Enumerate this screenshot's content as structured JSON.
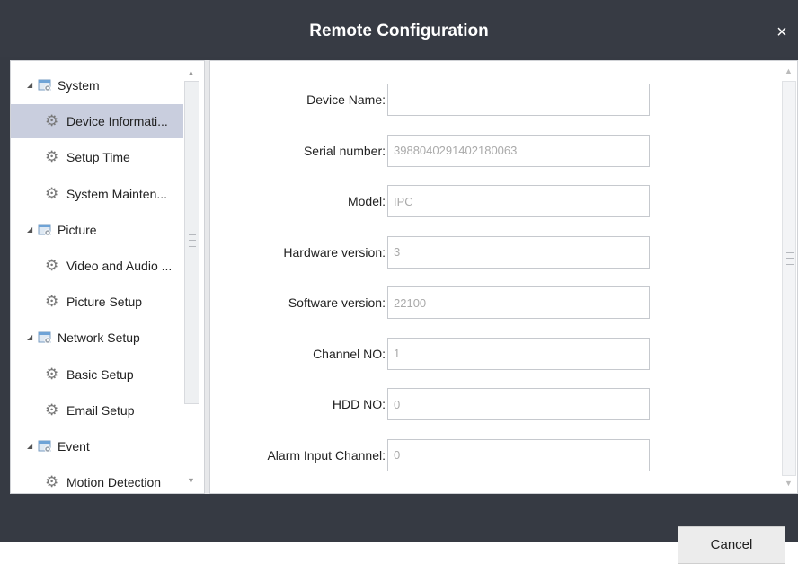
{
  "window": {
    "title": "Remote Configuration",
    "close_glyph": "×"
  },
  "tree": [
    {
      "label": "System",
      "type": "parent",
      "icon": "folder-gear-icon"
    },
    {
      "label": "Device Informati...",
      "type": "child",
      "selected": true,
      "icon": "gear-icon"
    },
    {
      "label": "Setup Time",
      "type": "child",
      "icon": "gear-icon"
    },
    {
      "label": "System Mainten...",
      "type": "child",
      "icon": "gear-icon"
    },
    {
      "label": "Picture",
      "type": "parent",
      "icon": "folder-gear-icon"
    },
    {
      "label": "Video and Audio ...",
      "type": "child",
      "icon": "gear-icon"
    },
    {
      "label": "Picture Setup",
      "type": "child",
      "icon": "gear-icon"
    },
    {
      "label": "Network Setup",
      "type": "parent",
      "icon": "folder-gear-icon"
    },
    {
      "label": "Basic Setup",
      "type": "child",
      "icon": "gear-icon"
    },
    {
      "label": "Email Setup",
      "type": "child",
      "icon": "gear-icon"
    },
    {
      "label": "Event",
      "type": "parent",
      "icon": "folder-gear-icon"
    },
    {
      "label": "Motion Detection",
      "type": "child",
      "icon": "gear-icon"
    }
  ],
  "form": {
    "fields": [
      {
        "label": "Device Name:",
        "value": "",
        "editable": true
      },
      {
        "label": "Serial number:",
        "value": "3988040291402180063",
        "editable": false
      },
      {
        "label": "Model:",
        "value": "IPC",
        "editable": false
      },
      {
        "label": "Hardware version:",
        "value": "3",
        "editable": false
      },
      {
        "label": "Software version:",
        "value": "22100",
        "editable": false
      },
      {
        "label": "Channel NO:",
        "value": "1",
        "editable": false
      },
      {
        "label": "HDD NO:",
        "value": "0",
        "editable": false
      },
      {
        "label": "Alarm Input Channel:",
        "value": "0",
        "editable": false
      }
    ]
  },
  "footer": {
    "cancel_label": "Cancel"
  },
  "colors": {
    "titlebar": "#373b44",
    "selected_row": "#c9cede",
    "panel_border": "#d0d2d6"
  }
}
